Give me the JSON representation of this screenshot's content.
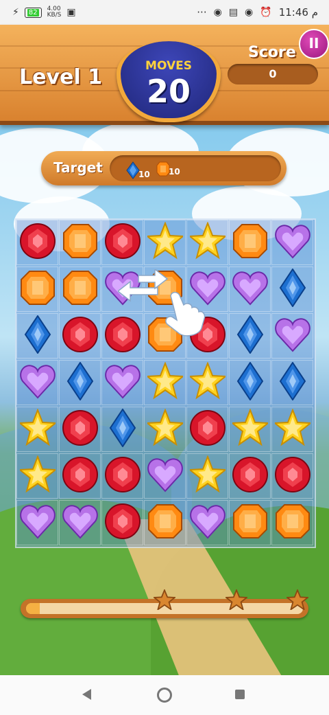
{
  "status_bar": {
    "battery": "82",
    "network_top": "4.00",
    "network_bottom": "KB/S",
    "dots": "···",
    "time": "11:46 م"
  },
  "header": {
    "level_label": "Level 1",
    "moves_label": "MOVES",
    "moves_value": "20",
    "score_label": "Score",
    "score_value": "0",
    "pause_label": "II"
  },
  "target": {
    "label": "Target",
    "items": [
      {
        "gem": "blue-gem",
        "count": "10"
      },
      {
        "gem": "orange-gem",
        "count": "10"
      }
    ]
  },
  "board": {
    "rows": 7,
    "cols": 7,
    "grid": [
      [
        "red",
        "orange",
        "red",
        "star",
        "star",
        "orange",
        "purple"
      ],
      [
        "orange",
        "orange",
        "purple",
        "orange",
        "purple",
        "purple",
        "blue"
      ],
      [
        "blue",
        "red",
        "red",
        "orange",
        "red",
        "blue",
        "purple"
      ],
      [
        "purple",
        "blue",
        "purple",
        "star",
        "star",
        "blue",
        "blue"
      ],
      [
        "star",
        "red",
        "blue",
        "star",
        "red",
        "star",
        "star"
      ],
      [
        "star",
        "red",
        "red",
        "purple",
        "star",
        "red",
        "red"
      ],
      [
        "purple",
        "purple",
        "red",
        "orange",
        "purple",
        "orange",
        "orange"
      ]
    ],
    "hint": "swap-hint-hand-icon"
  },
  "progress": {
    "fill_fraction": 0.05,
    "star_positions_fraction": [
      0.5,
      0.76,
      0.98
    ]
  },
  "colors": {
    "red": "#d8152a",
    "orange": "#ff8a12",
    "star": "#ffd21f",
    "purple": "#b772e8",
    "blue": "#1d6fd0"
  }
}
